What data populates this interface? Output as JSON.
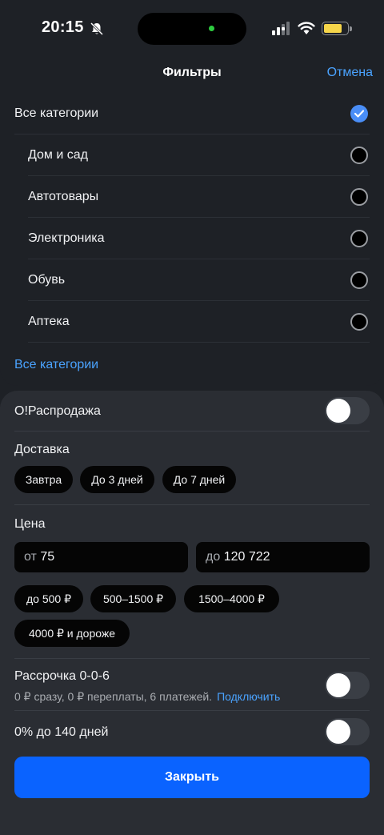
{
  "status_bar": {
    "time": "20:15",
    "icons": [
      "bell-slash-icon",
      "signal-icon",
      "wifi-icon",
      "battery-icon"
    ],
    "battery_level": 0.85
  },
  "header": {
    "title": "Фильтры",
    "cancel": "Отмена"
  },
  "categories": {
    "all": {
      "label": "Все категории",
      "checked": true
    },
    "items": [
      {
        "label": "Дом и сад",
        "checked": false
      },
      {
        "label": "Автотовары",
        "checked": false
      },
      {
        "label": "Электроника",
        "checked": false
      },
      {
        "label": "Обувь",
        "checked": false
      },
      {
        "label": "Аптека",
        "checked": false
      }
    ],
    "show_all_link": "Все категории"
  },
  "filters": {
    "sale": {
      "label": "О!Распродажа",
      "enabled": false
    },
    "delivery": {
      "label": "Доставка",
      "options": [
        "Завтра",
        "До 3 дней",
        "До 7 дней"
      ]
    },
    "price": {
      "label": "Цена",
      "from_prefix": "от",
      "from_value": "75",
      "to_prefix": "до",
      "to_value": "120 722",
      "ranges": [
        "до 500 ₽",
        "500–1500 ₽",
        "1500–4000 ₽",
        "4000 ₽ и дороже"
      ]
    },
    "installment": {
      "label": "Рассрочка 0-0-6",
      "description": "0 ₽ сразу, 0 ₽ переплаты, 6 платежей.",
      "link": "Подключить",
      "enabled": false
    },
    "zero_percent": {
      "label": "0% до 140 дней",
      "enabled": false
    }
  },
  "close_button": "Закрыть",
  "colors": {
    "background": "#1e2126",
    "panel": "#2a2d33",
    "accent_link": "#4aa3ff",
    "primary_button": "#0a63ff",
    "checkbox_checked": "#4a8ef7"
  }
}
